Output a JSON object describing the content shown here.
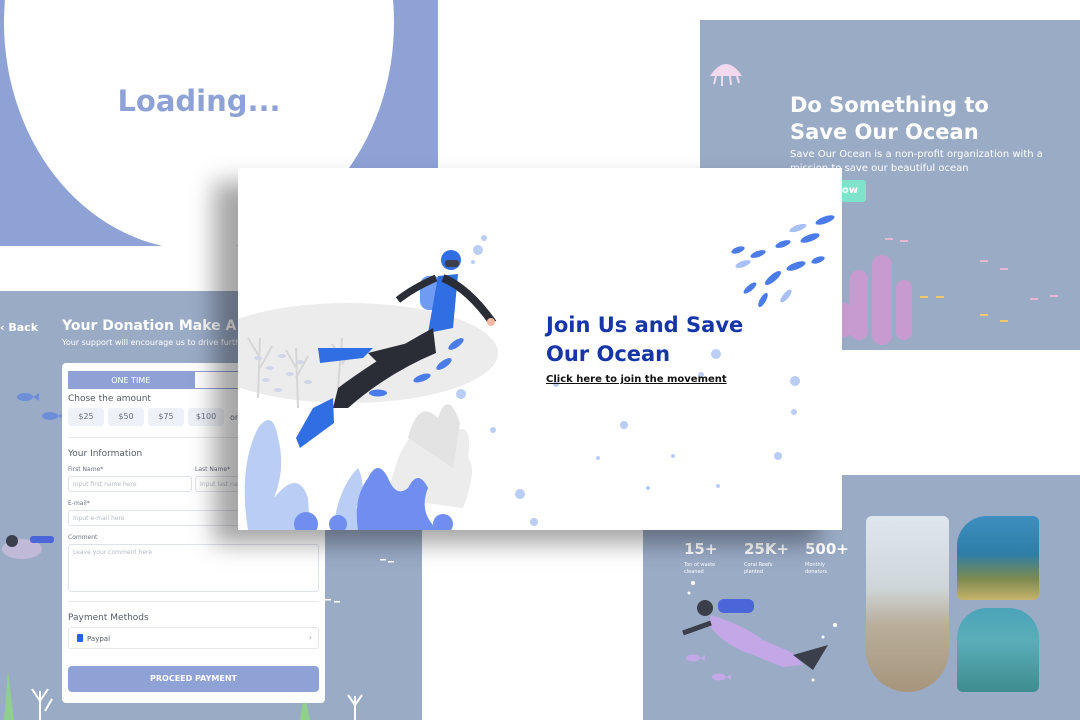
{
  "loading": {
    "text": "Loading..."
  },
  "hero": {
    "title_line1": "Do Something to",
    "title_line2": "Save Our Ocean",
    "subtitle": "Save Our Ocean is a non-profit organization with a mission to save our beautiful ocean",
    "button_label": "ow"
  },
  "donation": {
    "back_label": "Back",
    "title": "Your Donation Make A Di",
    "subtitle": "Your support will encourage us to drive furthe",
    "tabs": [
      "ONE TIME",
      ""
    ],
    "amount_heading": "Chose the amount",
    "amounts": [
      "$25",
      "$50",
      "$75",
      "$100"
    ],
    "or_label": "or",
    "info_heading": "Your Information",
    "first_name_label": "First Name*",
    "first_name_placeholder": "Input first name here",
    "last_name_label": "Last Name*",
    "last_name_placeholder": "Input last name here",
    "email_label": "E-mail*",
    "email_placeholder": "Input e-mail here",
    "comment_label": "Comment",
    "comment_placeholder": "Leave your comment here",
    "payment_heading": "Payment Methods",
    "payment_option": "Paypal",
    "proceed_label": "PROCEED PAYMENT"
  },
  "stats": [
    {
      "value": "15+",
      "label": "Ton of waste cleaned"
    },
    {
      "value": "25K+",
      "label": "Coral Reefs planted"
    },
    {
      "value": "500+",
      "label": "Monthly donators"
    }
  ],
  "front": {
    "title_line1": "Join Us and Save",
    "title_line2": "Our Ocean",
    "link_label": "Click here to join the movement"
  },
  "colors": {
    "primary": "#8ea2d6",
    "panel_bg": "#9aabc6",
    "title_blue": "#1636a8",
    "accent_green": "#7fe3cc",
    "diver_suit": "#3f6fe8",
    "coral_pink": "#d9a8d6"
  }
}
